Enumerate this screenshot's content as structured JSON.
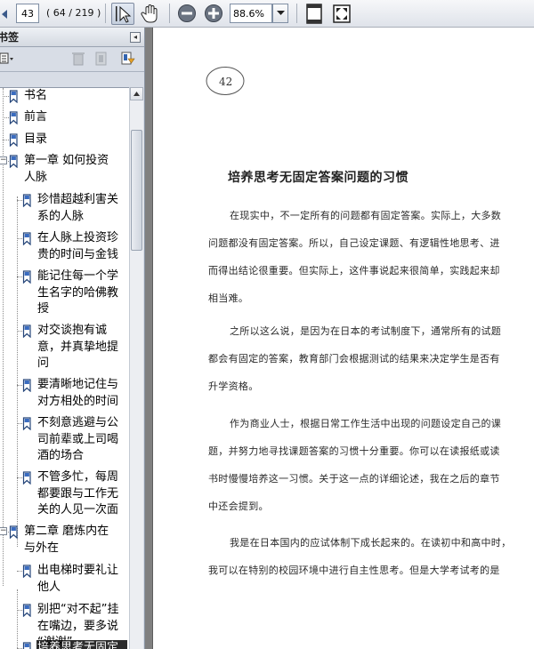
{
  "toolbar": {
    "page_current": "43",
    "page_count": "( 64 / 219 )",
    "zoom": "88.6%",
    "icons": [
      "select-cursor-icon",
      "hand-tool-icon",
      "zoom-out-icon",
      "zoom-in-icon",
      "fit-page-icon",
      "fit-width-icon"
    ]
  },
  "bookmarks": {
    "title": "书签",
    "collapse": "◂",
    "items": [
      {
        "lines": [
          "书名"
        ]
      },
      {
        "lines": [
          "前言"
        ]
      },
      {
        "lines": [
          "目录"
        ]
      },
      {
        "lines": [
          "第一章  如何投资",
          "人脉"
        ],
        "expanded": true
      },
      {
        "lines": [
          "珍惜超越利害关",
          "系的人脉"
        ]
      },
      {
        "lines": [
          "在人脉上投资珍",
          "贵的时间与金钱"
        ]
      },
      {
        "lines": [
          "能记住每一个学",
          "生名字的哈佛教",
          "授"
        ]
      },
      {
        "lines": [
          "对交谈抱有诚",
          "意，并真挚地提",
          "问"
        ]
      },
      {
        "lines": [
          "要清晰地记住与",
          "对方相处的时间"
        ]
      },
      {
        "lines": [
          "不刻意逃避与公",
          "司前辈或上司喝",
          "酒的场合"
        ]
      },
      {
        "lines": [
          "不管多忙，每周",
          "都要跟与工作无",
          "关的人见一次面"
        ]
      },
      {
        "lines": [
          "第二章  磨炼内在",
          "与外在"
        ],
        "expanded": true
      },
      {
        "lines": [
          "出电梯时要礼让",
          "他人"
        ]
      },
      {
        "lines": [
          "别把“对不起”挂",
          "在嘴边，要多说",
          "“谢谢”"
        ]
      },
      {
        "lines": [
          "培养思考无固定"
        ],
        "selected": true
      }
    ]
  },
  "document": {
    "page_number": "42",
    "section_title": "培养思考无固定答案问题的习惯",
    "paragraphs": [
      [
        "在现实中，不一定所有的问题都有固定答案。实际上，大多数",
        "问题都没有固定答案。所以，自己设定课题、有逻辑性地思考、进",
        "而得出结论很重要。但实际上，这件事说起来很简单，实践起来却",
        "相当难。"
      ],
      [
        "之所以这么说，是因为在日本的考试制度下，通常所有的试题",
        "都会有固定的答案，教育部门会根据测试的结果来决定学生是否有",
        "升学资格。"
      ],
      [
        "作为商业人士，根据日常工作生活中出现的问题设定自己的课",
        "题，并努力地寻找课题答案的习惯十分重要。你可以在读报纸或读",
        "书时慢慢培养这一习惯。关于这一点的详细论述，我在之后的章节",
        "中还会提到。"
      ],
      [
        "我是在日本国内的应试体制下成长起来的。在读初中和高中时，",
        "我可以在特别的校园环境中进行自主性思考。但是大学考试考的是"
      ]
    ]
  }
}
